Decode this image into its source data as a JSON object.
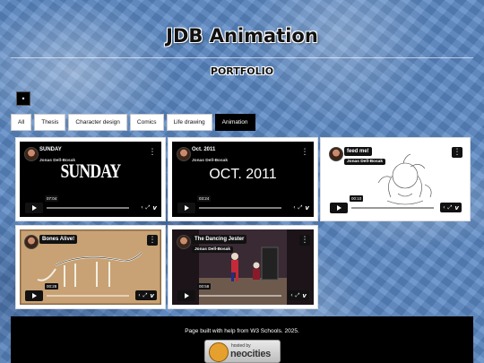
{
  "header": {
    "title": "JDB Animation",
    "section": "PORTFOLIO"
  },
  "menu": {
    "icon": "menu-dot-icon"
  },
  "tabs": [
    {
      "label": "All"
    },
    {
      "label": "Thesis"
    },
    {
      "label": "Character design"
    },
    {
      "label": "Comics"
    },
    {
      "label": "Life drawing"
    },
    {
      "label": "Animation",
      "active": true
    }
  ],
  "videos": [
    {
      "title": "SUNDAY",
      "author": "Jonas Dell-Bosak",
      "display_text": "SUNDAY",
      "time": "07:04"
    },
    {
      "title": "Oct. 2011",
      "author": "Jonas Dell-Bosak",
      "display_text": "OCT. 2011",
      "time": "03:24"
    },
    {
      "title": "feed me!",
      "author": "Jonas Dell-Bosak",
      "time": "00:10"
    },
    {
      "title": "Bones Alive!",
      "author": "Jonas Dell-Bosak",
      "time": "00:28"
    },
    {
      "title": "The Dancing Jester",
      "author": "Jonas Dell-Bosak",
      "time": "00:58"
    }
  ],
  "player_controls": {
    "platform": "vimeo",
    "play": "play-icon",
    "more": "more-dots-icon"
  },
  "footer": {
    "text": "Page built with help from W3 Schools. 2025.",
    "badge_small": "hosted by",
    "badge_big": "neocities"
  }
}
